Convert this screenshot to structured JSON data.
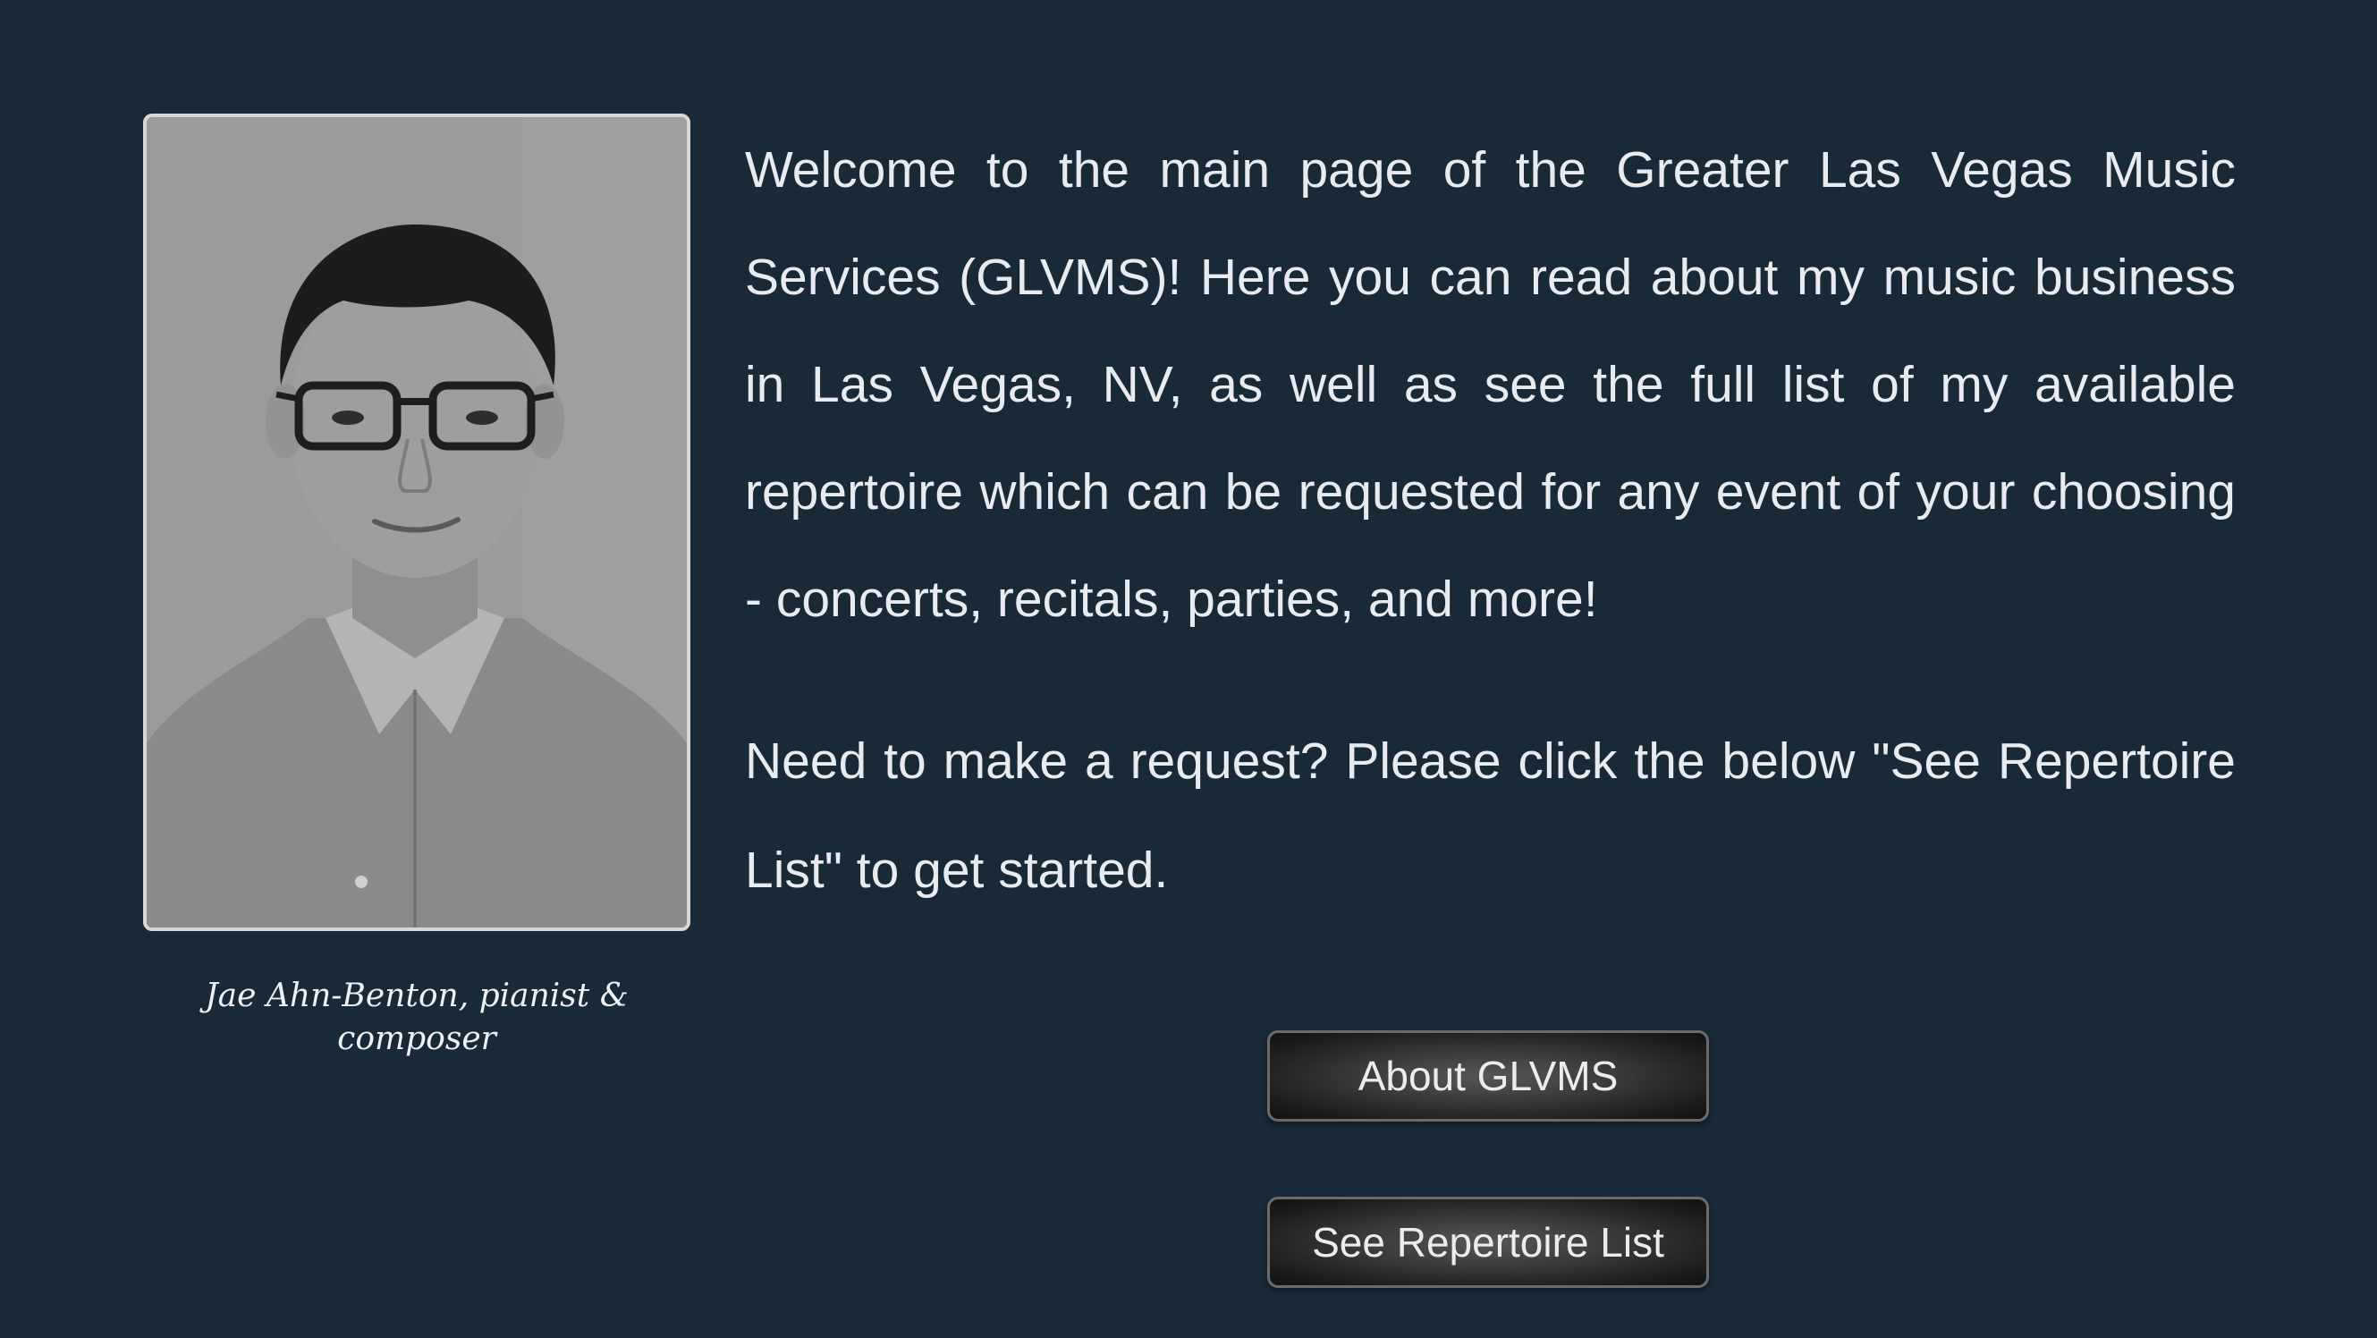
{
  "profile": {
    "caption": "Jae Ahn-Benton, pianist & composer"
  },
  "intro": {
    "welcome": "Welcome to the main page of the Greater Las Vegas Music Services (GLVMS)! Here you can read about my music business in Las Vegas, NV, as well as see the full list of my available repertoire which can be requested for any event of your choosing - concerts, recitals, parties, and more!",
    "request": "Need to make a request? Please click the below \"See Repertoire List\" to get started."
  },
  "buttons": {
    "about_label": "About GLVMS",
    "repertoire_label": "See Repertoire List"
  },
  "colors": {
    "background": "#182938",
    "text": "#e8ecf0",
    "button_border": "#6b6b6b"
  }
}
